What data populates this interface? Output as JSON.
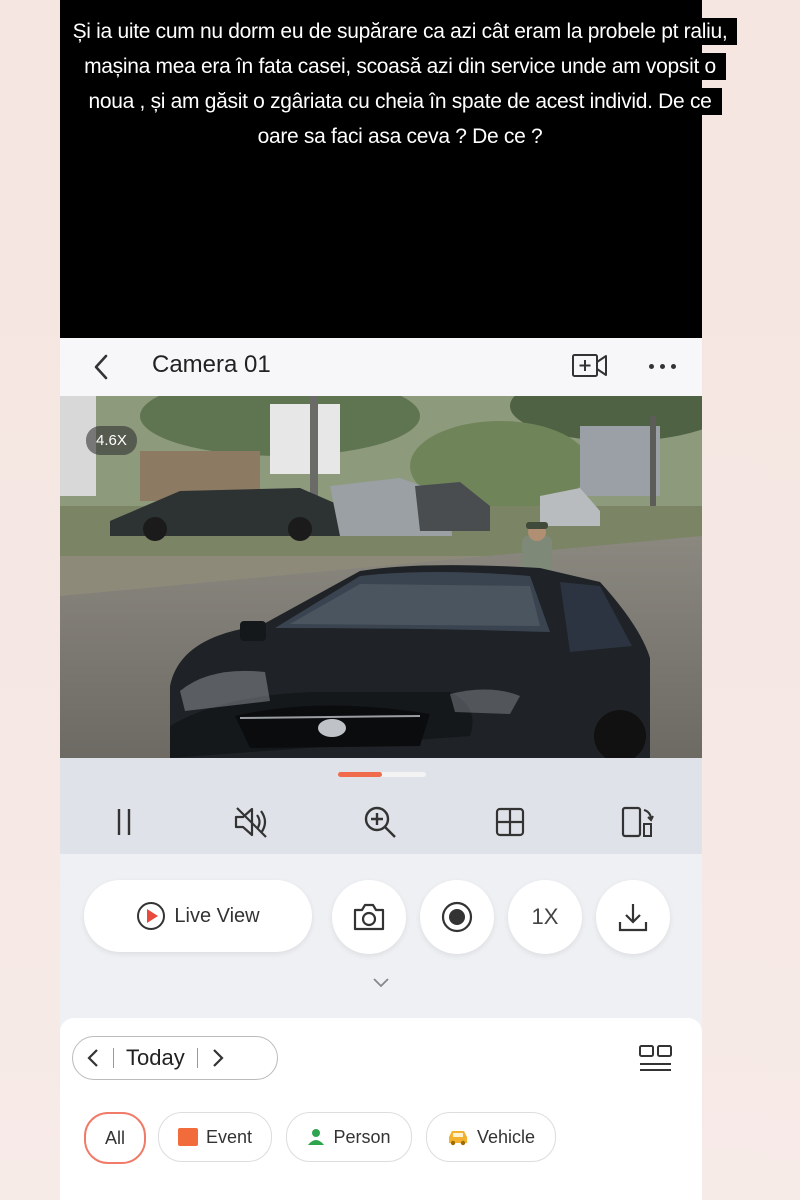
{
  "caption": {
    "lines": [
      "Și ia uite cum nu dorm eu de supărare ca azi cât eram la probele pt raliu,",
      "mașina mea era în fata casei,  scoasă azi din service unde am vopsit o",
      "noua , și am găsit o zgâriata cu cheia în spate de acest individ. De ce",
      "oare sa faci asa ceva ? De ce ?"
    ]
  },
  "header": {
    "title": "Camera 01",
    "back_icon": "chevron-left-icon",
    "add_camera_icon": "camera-add-icon",
    "more_icon": "more-dots-icon"
  },
  "video": {
    "zoom_level": "4.6X"
  },
  "controls": {
    "icons": [
      "pause-icon",
      "mute-icon",
      "zoom-in-icon",
      "grid-layout-icon",
      "rotate-screen-icon"
    ]
  },
  "actions": {
    "live_view_label": "Live View",
    "speed_label": "1X",
    "icons": [
      "play-icon",
      "snapshot-icon",
      "record-icon",
      "download-icon"
    ]
  },
  "date_nav": {
    "label": "Today"
  },
  "filters": [
    {
      "label": "All",
      "active": true
    },
    {
      "label": "Event",
      "icon": "event-icon"
    },
    {
      "label": "Person",
      "icon": "person-icon"
    },
    {
      "label": "Vehicle",
      "icon": "vehicle-icon"
    }
  ],
  "colors": {
    "accent": "#f26b3a",
    "active_chip_border": "#f07b68",
    "record_red": "#e84b3c"
  }
}
